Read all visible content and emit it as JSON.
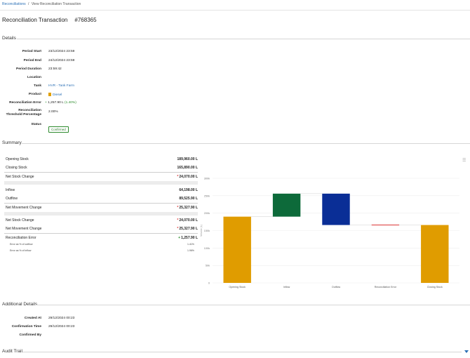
{
  "breadcrumb": {
    "root": "Reconciliations",
    "sep": "/",
    "current": "View Reconciliation Transaction"
  },
  "page_title": {
    "label": "Reconciliation Transaction",
    "id": "#768365"
  },
  "sections": {
    "details": "Details",
    "summary": "Summary",
    "additional": "Additional Details",
    "audit": "Audit Trail"
  },
  "details": {
    "period_start": {
      "label": "Period Start",
      "value": "23/12/2024 23:59"
    },
    "period_end": {
      "label": "Period End",
      "value": "24/12/2024 23:59"
    },
    "period_duration": {
      "label": "Period Duration",
      "value": "23:59:42"
    },
    "location": {
      "label": "Location",
      "value": ""
    },
    "tank": {
      "label": "Tank",
      "value": "HVR - Tank Farm"
    },
    "product": {
      "label": "Product",
      "value": "Diesel",
      "color": "#e0a000"
    },
    "recon_error": {
      "label": "Reconciliation Error",
      "prefix": "+",
      "value": "1,257.90 L",
      "pct": "(1.40%)"
    },
    "threshold": {
      "label": "Reconciliation Threshold Percentage",
      "value": "2.00%"
    },
    "status": {
      "label": "Status",
      "value": "Confirmed"
    }
  },
  "summary": {
    "opening": {
      "label": "Opening Stock",
      "value": "189,960.00 L"
    },
    "closing": {
      "label": "Closing Stock",
      "value": "165,890.00 L"
    },
    "net_change_1": {
      "label": "Net Stock Change",
      "value": "24,070.00 L"
    },
    "inflow": {
      "label": "Inflow",
      "value": "64,198.00 L"
    },
    "outflow": {
      "label": "Outflow",
      "value": "89,525.90 L"
    },
    "net_movement_1": {
      "label": "Net Movement Change",
      "value": "25,327.90 L"
    },
    "net_change_2": {
      "label": "Net Stock Change",
      "value": "24,070.00 L"
    },
    "net_movement_2": {
      "label": "Net Movement Change",
      "value": "25,327.90 L"
    },
    "recon_error": {
      "label": "Reconciliation Error",
      "value": "1,257.90 L"
    },
    "err_outflow": {
      "label": "Error as % of outflow",
      "value": "1.41%"
    },
    "err_inflow": {
      "label": "Error as % of inflow",
      "value": "1.96%"
    }
  },
  "chart_data": {
    "type": "bar",
    "subtype": "waterfall",
    "categories": [
      "Opening Stock",
      "Inflow",
      "Outflow",
      "Reconciliation Error",
      "Closing Stock"
    ],
    "bars": [
      {
        "category": "Opening Stock",
        "start": 0,
        "end": 190000,
        "color": "#e09c00"
      },
      {
        "category": "Inflow",
        "start": 190000,
        "end": 256000,
        "color": "#0d6a3a"
      },
      {
        "category": "Outflow",
        "start": 256000,
        "end": 166000,
        "color": "#0a2e96"
      },
      {
        "category": "Reconciliation Error",
        "start": 167300,
        "end": 166000,
        "color": "#e05050"
      },
      {
        "category": "Closing Stock",
        "start": 0,
        "end": 166000,
        "color": "#e09c00"
      }
    ],
    "yticks": [
      "0",
      "50k",
      "100k",
      "150k",
      "200k",
      "250k",
      "300k"
    ],
    "ylim": [
      0,
      300000
    ],
    "ylabel": "Volume (L)",
    "grid": true
  },
  "additional": {
    "created": {
      "label": "Created At",
      "value": "29/12/2024 00:23"
    },
    "confirmed_time": {
      "label": "Confirmation Time",
      "value": "29/12/2024 00:23"
    },
    "confirmed_by": {
      "label": "Confirmed By",
      "value": ""
    }
  },
  "icons": {
    "chart_menu": "menu-icon",
    "audit_toggle": "chevron-down-icon"
  }
}
